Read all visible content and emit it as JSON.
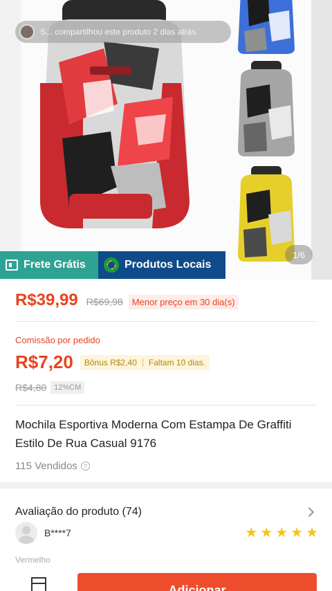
{
  "hero": {
    "share_text": "S... compartilhou este produto 2 dias atrás",
    "counter": "1/6"
  },
  "badges": {
    "frete": "Frete Grátis",
    "locais": "Produtos Locais"
  },
  "price": {
    "current": "R$39,99",
    "original": "R$69,98",
    "lowest_tag": "Menor preço em 30 dia(s)"
  },
  "commission": {
    "label": "Comissão por pedido",
    "value": "R$7,20",
    "bonus": "Bônus R$2,40",
    "remaining": "Faltam 10 dias.",
    "old_value": "R$4,80",
    "cm_tag": "12%CM"
  },
  "product": {
    "title": "Mochila Esportiva Moderna Com Estampa De Graffiti Estilo De Rua Casual 9176",
    "sold": "115 Vendidos"
  },
  "reviews": {
    "title": "Avaliação do produto (74)",
    "reviewer": "B****7",
    "rating": 5,
    "variant": "Vermelho"
  },
  "bottom": {
    "add_label": "Adicionar"
  },
  "colors": {
    "accent": "#ee4d2d",
    "price": "#e8431f",
    "frete_bg": "#2ea394",
    "locais_bg": "#0f4b8a",
    "star": "#f5c518"
  }
}
